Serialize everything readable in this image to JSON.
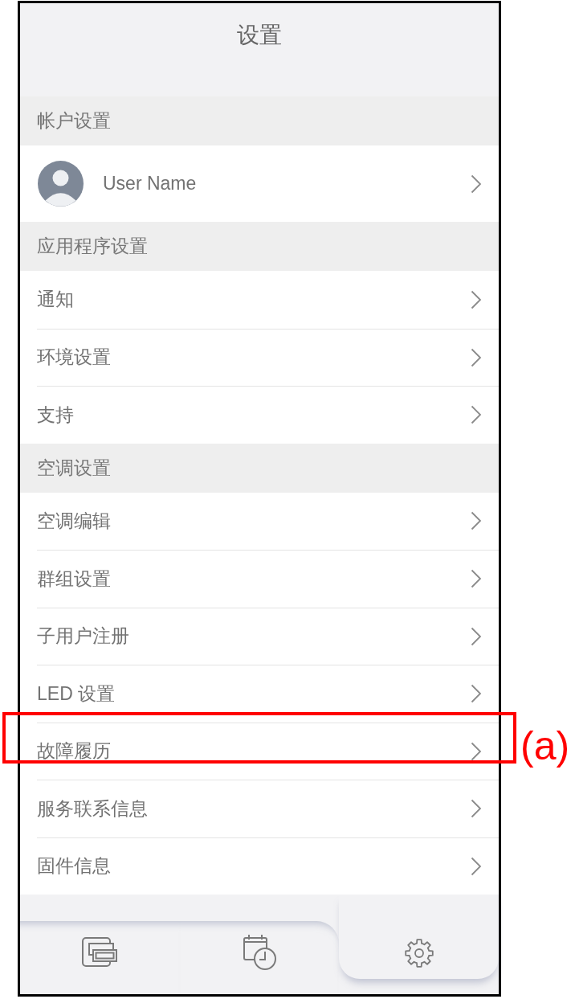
{
  "header": {
    "title": "设置"
  },
  "sections": [
    {
      "title": "帐户设置",
      "items": [
        {
          "kind": "account",
          "label": "User Name",
          "marked": false
        }
      ]
    },
    {
      "title": "应用程序设置",
      "items": [
        {
          "kind": "link",
          "label": "通知",
          "marked": false
        },
        {
          "kind": "link",
          "label": "环境设置",
          "marked": false
        },
        {
          "kind": "link",
          "label": "支持",
          "marked": false
        }
      ]
    },
    {
      "title": "空调设置",
      "items": [
        {
          "kind": "link",
          "label": "空调编辑",
          "marked": false
        },
        {
          "kind": "link",
          "label": "群组设置",
          "marked": false
        },
        {
          "kind": "link",
          "label": "子用户注册",
          "marked": false
        },
        {
          "kind": "link",
          "label": "LED 设置",
          "marked": false
        },
        {
          "kind": "link",
          "label": "故障履历",
          "marked": true
        },
        {
          "kind": "link",
          "label": "服务联系信息",
          "marked": false
        },
        {
          "kind": "link",
          "label": "固件信息",
          "marked": false
        }
      ]
    }
  ],
  "callout": {
    "label": "(a)"
  },
  "tab_bar": {
    "tabs": [
      {
        "kind": "devices",
        "selected": false
      },
      {
        "kind": "schedule",
        "selected": false
      },
      {
        "kind": "settings",
        "selected": true
      }
    ]
  }
}
